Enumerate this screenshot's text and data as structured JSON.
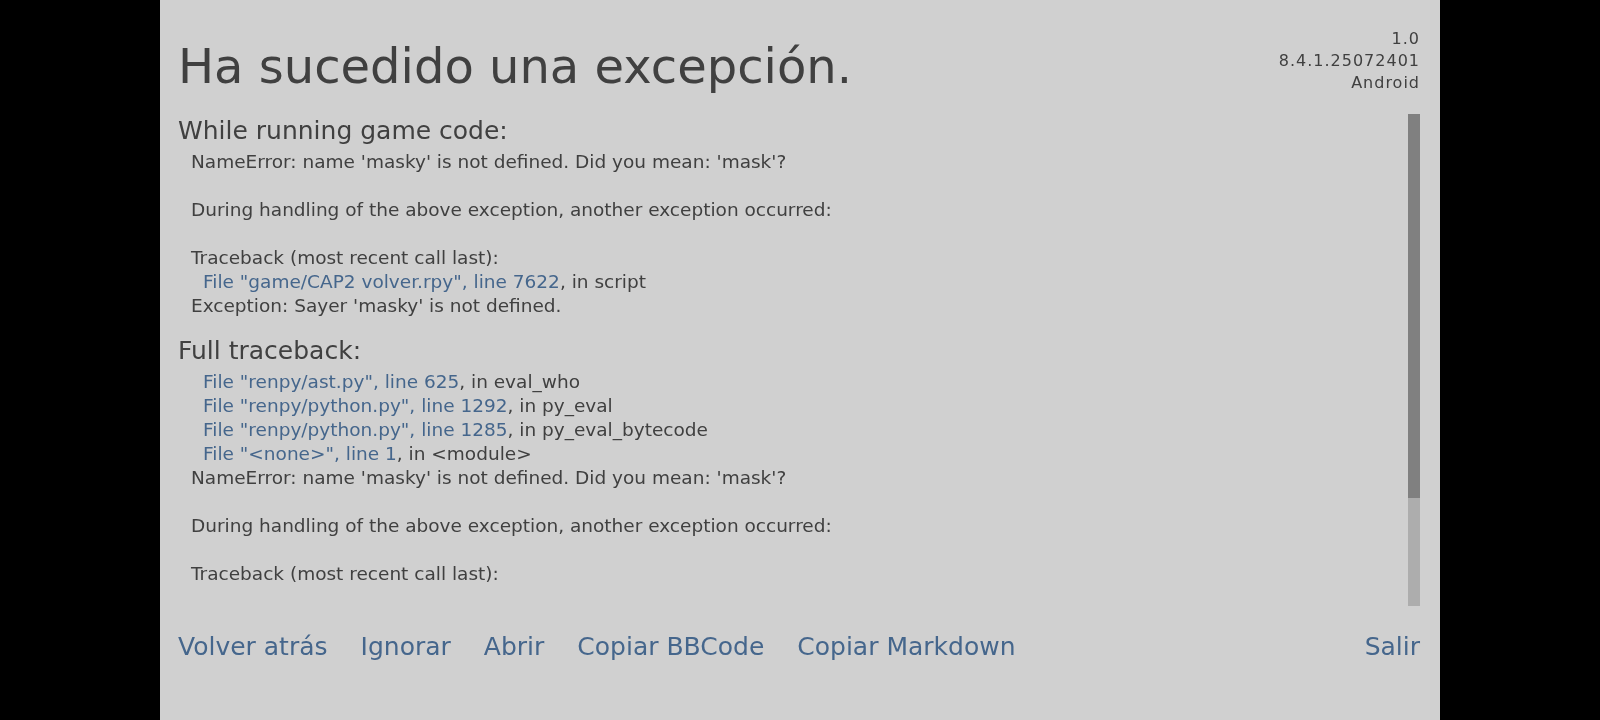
{
  "title": "Ha sucedido una excepción.",
  "version_info": [
    "1.0",
    "8.4.1.25072401",
    "Android"
  ],
  "sections": [
    {
      "heading": "While running game code:",
      "lines": [
        {
          "kind": "text",
          "text": "NameError: name 'masky' is not defined. Did you mean: 'mask'?"
        },
        {
          "kind": "blank"
        },
        {
          "kind": "text",
          "text": "During handling of the above exception, another exception occurred:"
        },
        {
          "kind": "blank"
        },
        {
          "kind": "text",
          "text": "Traceback (most recent call last):"
        },
        {
          "kind": "frame",
          "link": "File \"game/CAP2 volver.rpy\", line 7622",
          "text": ", in script"
        },
        {
          "kind": "text",
          "text": "Exception: Sayer 'masky' is not defined."
        }
      ]
    },
    {
      "heading": "Full traceback:",
      "lines": [
        {
          "kind": "frame",
          "link": "File \"renpy/ast.py\", line 625",
          "text": ", in eval_who"
        },
        {
          "kind": "frame",
          "link": "File \"renpy/python.py\", line 1292",
          "text": ", in py_eval"
        },
        {
          "kind": "frame",
          "link": "File \"renpy/python.py\", line 1285",
          "text": ", in py_eval_bytecode"
        },
        {
          "kind": "frame",
          "link": "File \"<none>\", line 1",
          "text": ", in <module>"
        },
        {
          "kind": "text",
          "text": "NameError: name 'masky' is not defined. Did you mean: 'mask'?"
        },
        {
          "kind": "blank"
        },
        {
          "kind": "text",
          "text": "During handling of the above exception, another exception occurred:"
        },
        {
          "kind": "blank"
        },
        {
          "kind": "text",
          "text": "Traceback (most recent call last):"
        }
      ]
    }
  ],
  "actions": [
    "Volver atrás",
    "Ignorar",
    "Abrir",
    "Copiar BBCode",
    "Copiar Markdown"
  ],
  "quit": "Salir"
}
